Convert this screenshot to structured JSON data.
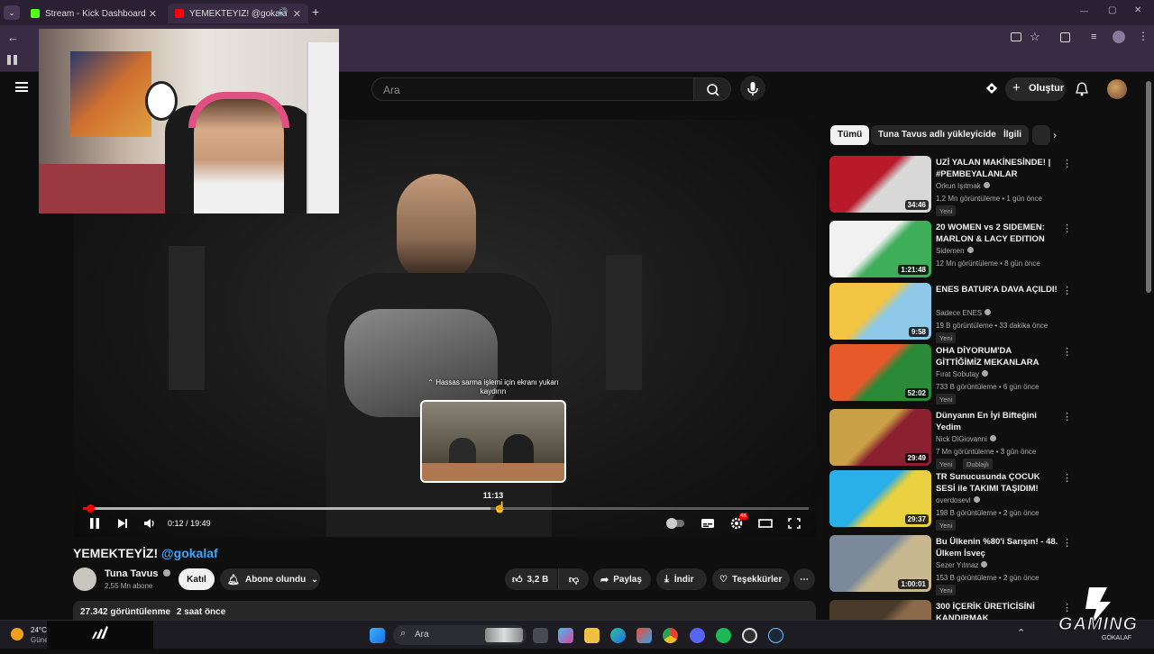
{
  "browser": {
    "tabs": [
      {
        "title": "Stream - Kick Dashboard",
        "color": "#53fc18"
      },
      {
        "title": "YEMEKTEYİZ! @gokalaf - Yo",
        "color": "#ff0000"
      }
    ],
    "new_tab": "+",
    "window_controls": [
      "—",
      "▢",
      "✕"
    ]
  },
  "youtube": {
    "search_placeholder": "Ara",
    "create_label": "Oluştur"
  },
  "player": {
    "time_current": "0:12",
    "time_total": "19:49",
    "time_separator": "/",
    "progress_played": 0.0101,
    "progress_hover": 0.5618,
    "preview_tooltip": "⌃ Hassas sarma işlemi için ekranı yukarı kaydırın",
    "preview_time": "11:13",
    "settings_badge": "4K"
  },
  "video": {
    "title": "YEMEKTEYİZ!",
    "title_handle": "@gokalaf",
    "channel": "Tuna Tavus",
    "subscribers": "2,55 Mn abone",
    "join_label": "Katıl",
    "subscribed_label": "Abone olundu",
    "likes": "3,2 B",
    "share_label": "Paylaş",
    "download_label": "İndir",
    "thanks_label": "Teşekkürler",
    "views": "27.342 görüntülenme",
    "age": "2 saat önce"
  },
  "sidebar": {
    "chips": [
      "Tümü",
      "Tuna Tavus adlı yükleyiciden",
      "İlgili"
    ],
    "recommendations": [
      {
        "title": "UZİ YALAN MAKİNESİNDE! | #PEMBEYALANLAR",
        "channel": "Orkun Işıtmak",
        "meta": "1,2 Mn görüntüleme • 1 gün önce",
        "badge": "Yeni",
        "duration": "34:46",
        "thumb": [
          "#b81a2a",
          "#d8d8d8"
        ]
      },
      {
        "title": "20 WOMEN vs 2 SIDEMEN: MARLON & LACY EDITION",
        "channel": "Sidemen",
        "meta": "12 Mn görüntüleme • 8 gün önce",
        "badge": "",
        "duration": "1:21:48",
        "thumb": [
          "#f2f2f2",
          "#3fae5a"
        ]
      },
      {
        "title": "ENES BATUR'A DAVA AÇILDI!",
        "channel": "Sadece ENES",
        "meta": "19 B görüntüleme • 33 dakika önce",
        "badge": "Yeni",
        "duration": "9:58",
        "thumb": [
          "#f4c542",
          "#8ec8e8"
        ]
      },
      {
        "title": "OHA DİYORUM'DA GİTTİĞİMİZ MEKANLARA GİTTİK! ...",
        "channel": "Fırat Sobutay",
        "meta": "733 B görüntüleme • 6 gün önce",
        "badge": "Yeni",
        "duration": "52:02",
        "thumb": [
          "#e85a2a",
          "#2a8a3a"
        ]
      },
      {
        "title": "Dünyanın En İyi Bifteğini Yedim",
        "channel": "Nick DiGiovanni",
        "meta": "7 Mn görüntüleme • 3 gün önce",
        "badge": "Yeni",
        "badge2": "Dublajlı",
        "duration": "29:49",
        "thumb": [
          "#c9a046",
          "#8a2030"
        ]
      },
      {
        "title": "TR Sunucusunda ÇOCUK SESİ ile TAKIMI TAŞIDIM! (nasıl tep...",
        "channel": "overdosevl",
        "meta": "198 B görüntüleme • 2 gün önce",
        "badge": "Yeni",
        "duration": "29:37",
        "thumb": [
          "#2ab0e8",
          "#e8d040"
        ]
      },
      {
        "title": "Bu Ülkenin %80'i Sarışın! - 48. Ülkem İsveç",
        "channel": "Sezer Yılmaz",
        "meta": "153 B görüntüleme • 2 gün önce",
        "badge": "Yeni",
        "duration": "1:00:01",
        "thumb": [
          "#7a8a9a",
          "#c8b890"
        ]
      },
      {
        "title": "300 İÇERİK ÜRETİCİSİNİ KANDIRMAK",
        "channel": "",
        "meta": "",
        "badge": "",
        "duration": "",
        "thumb": [
          "#4a3a2a",
          "#8a6a4a"
        ]
      }
    ]
  },
  "taskbar": {
    "weather_temp": "24°C",
    "weather_desc": "Güne",
    "search_label": "Ara"
  },
  "overlay": {
    "brand": "GAMING",
    "sub": "GÖKALAF"
  },
  "colors": {
    "accent_red": "#ff0000",
    "link_blue": "#3ea6ff",
    "bg": "#0f0f0f",
    "surface": "#272727"
  }
}
